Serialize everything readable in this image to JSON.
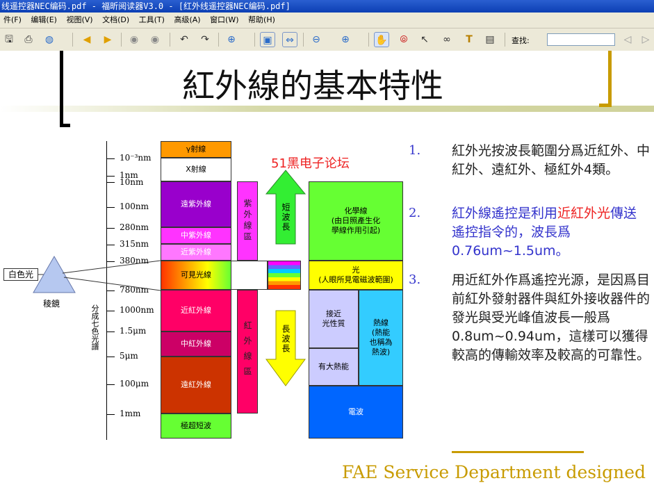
{
  "window": {
    "title": "线遥控器NEC编码.pdf - 福昕阅读器V3.0 - [红外线遥控器NEC编码.pdf]"
  },
  "menu": [
    "件(F)",
    "编辑(E)",
    "视图(V)",
    "文档(D)",
    "工具(T)",
    "高级(A)",
    "窗口(W)",
    "帮助(H)"
  ],
  "toolbar": {
    "find_label": "查找:",
    "find_value": "",
    "icons": [
      "save-icon",
      "print-icon",
      "globe-icon",
      "prev-page-icon",
      "next-page-icon",
      "back-icon",
      "forward-icon",
      "rotate-left-icon",
      "rotate-right-icon",
      "zoom-in-icon",
      "fit-page-icon",
      "fit-width-icon",
      "zoom-out-minus-icon",
      "zoom-in-plus-icon",
      "hand-tool-icon",
      "glasses-icon",
      "select-arrow-icon",
      "binoculars-icon",
      "text-select-icon",
      "snapshot-icon",
      "find-prev-icon",
      "find-next-icon"
    ]
  },
  "slide": {
    "title": "紅外線的基本特性",
    "watermark": "51黑电子论坛",
    "footer": "FAE Service Department designed",
    "spectrum": {
      "wavelengths": [
        "10⁻³nm",
        "1nm",
        "10nm",
        "100nm",
        "280nm",
        "315nm",
        "380nm",
        "780nm",
        "1000nm",
        "1.5μm",
        "5μm",
        "100μm",
        "1mm"
      ],
      "bands": [
        "γ射線",
        "X射線",
        "遠紫外線",
        "中紫外線",
        "近紫外線",
        "可見光線",
        "近紅外線",
        "中紅外線",
        "遠紅外線",
        "極超短波"
      ],
      "uv_region": "紫外線區",
      "ir_region": "紅外線區",
      "short_wave": "短波長",
      "long_wave": "長波長",
      "white_light": "白色光",
      "prism": "稜鏡",
      "spectrum_label": "分成七色光譜",
      "chemical": "化學線\n(由日照產生化\n學線作用引起)",
      "light": "光\n(人眼所見電磁波範圍)",
      "near_light": "接近\n光性質",
      "heat": "熱線\n(熱能\n也稱為\n熱波)",
      "big_heat": "有大熱能",
      "radio": "電波"
    },
    "points": [
      {
        "num": "1.",
        "text": "紅外光按波長範圍分爲近紅外、中紅外、遠紅外、極紅外4類。"
      },
      {
        "num": "2.",
        "text_blue1": "紅外線遙控是利用",
        "text_red": "近紅外光",
        "text_blue2": "傳送遙控指令的，波長爲0.76um~1.5um。"
      },
      {
        "num": "3.",
        "text": "用近紅外作爲遙控光源，是因爲目前紅外發射器件與紅外接收器件的發光與受光峰值波長一般爲0.8um~0.94um，這樣可以獲得較高的傳輸效率及較高的可靠性。"
      }
    ]
  }
}
